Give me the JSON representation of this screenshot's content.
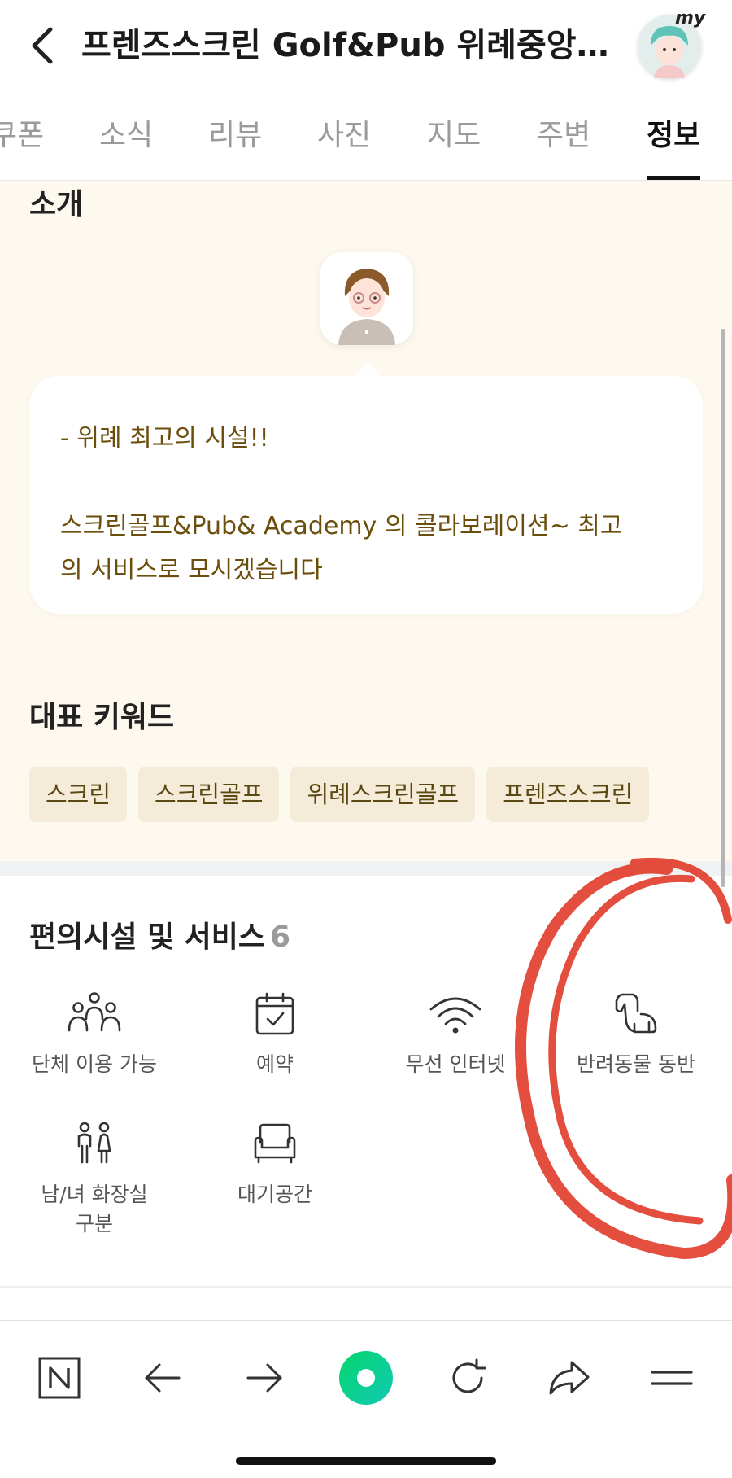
{
  "header": {
    "title": "프렌즈스크린 Golf&Pub 위례중앙...",
    "my_badge": "my"
  },
  "tabs": [
    {
      "label": "쿠폰"
    },
    {
      "label": "소식"
    },
    {
      "label": "리뷰"
    },
    {
      "label": "사진"
    },
    {
      "label": "지도"
    },
    {
      "label": "주변"
    },
    {
      "label": "정보",
      "active": true
    }
  ],
  "intro": {
    "heading": "소개",
    "line1": "- 위례 최고의 시설!!",
    "line2": "스크린골프&Pub& Academy 의 콜라보레이션~ 최고",
    "line3": "의 서비스로 모시겠습니다"
  },
  "keywords": {
    "heading": "대표 키워드",
    "items": [
      "스크린",
      "스크린골프",
      "위례스크린골프",
      "프렌즈스크린"
    ]
  },
  "amenities": {
    "heading": "편의시설 및 서비스",
    "count": "6",
    "items": [
      {
        "label": "단체 이용 가능",
        "icon": "group-icon"
      },
      {
        "label": "예약",
        "icon": "calendar-check-icon"
      },
      {
        "label": "무선 인터넷",
        "icon": "wifi-icon"
      },
      {
        "label": "반려동물 동반",
        "icon": "dog-icon"
      },
      {
        "label_line1": "남/녀 화장실",
        "label_line2": "구분",
        "icon": "restroom-icon"
      },
      {
        "label": "대기공간",
        "icon": "sofa-icon"
      }
    ]
  },
  "bottom_bar": {
    "icons": [
      "naver-n-icon",
      "back-arrow-icon",
      "forward-arrow-icon",
      "green-dot-icon",
      "refresh-icon",
      "share-icon",
      "menu-icon"
    ]
  },
  "colors": {
    "intro_bg": "#fdf9ee",
    "keyword_bg": "#f4ecd9",
    "intro_text": "#6b4e0c",
    "accent_green": "#03c75a",
    "annotation_red": "#e0301e"
  }
}
